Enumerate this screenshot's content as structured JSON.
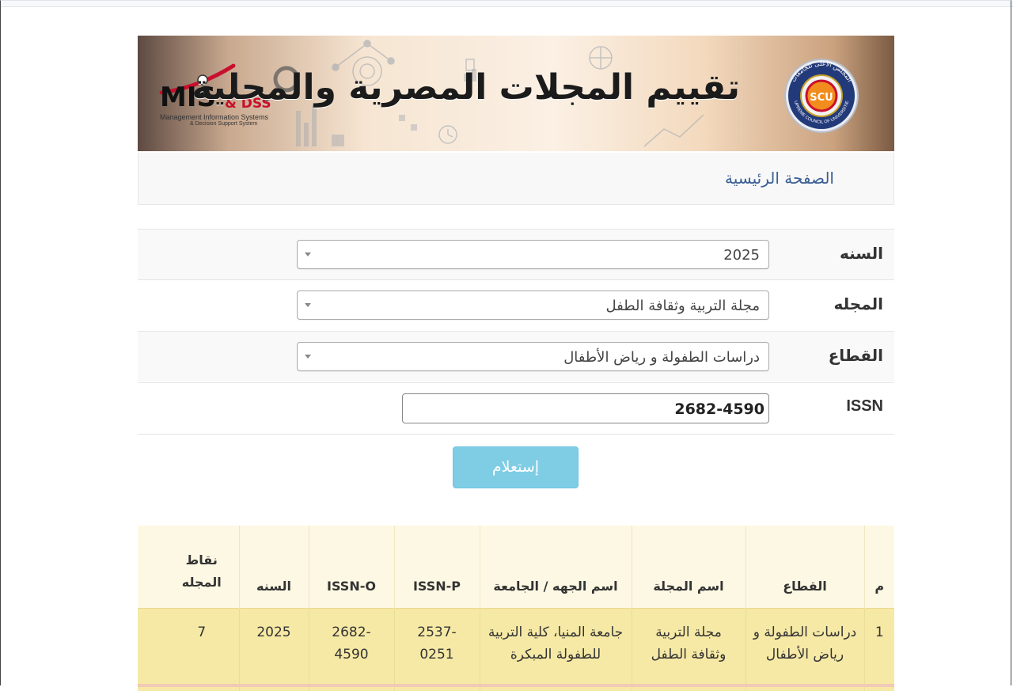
{
  "banner": {
    "title": "تقييم المجلات المصرية والمحلية",
    "left_logo": {
      "main": "MIS",
      "amp": "& DSS",
      "line1": "Management Information Systems",
      "line2": "& Decision Support System"
    },
    "right_logo": {
      "initials": "SCU",
      "arabic_name": "المجلس الأعلى للجامعات",
      "english_name": "SUPREME COUNCIL OF UNIVERSITIES"
    }
  },
  "nav": {
    "home_label": "الصفحة الرئيسية"
  },
  "form": {
    "year": {
      "label": "السنه",
      "value": "2025"
    },
    "journal": {
      "label": "المجله",
      "value": "مجلة التربية وثقافة الطفل"
    },
    "sector": {
      "label": "القطاع",
      "value": "دراسات الطفولة و رياض الأطفال"
    },
    "issn": {
      "label": "ISSN",
      "value": "2682-4590"
    },
    "submit_label": "إستعلام"
  },
  "results": {
    "headers": [
      "م",
      "القطاع",
      "اسم المجلة",
      "اسم الجهه / الجامعة",
      "ISSN-P",
      "ISSN-O",
      "السنه",
      "نقاط المجله"
    ],
    "rows": [
      [
        "1",
        "دراسات الطفولة و رياض الأطفال",
        "مجلة التربية وثقافة الطفل",
        "جامعة المنيا، كلية التربية للطفولة المبكرة",
        "2537-0251",
        "2682-4590",
        "2025",
        "7"
      ]
    ]
  },
  "colors": {
    "button": "#5bc0de",
    "table_header": "#fcf8e3",
    "table_row": "#f6e9a5",
    "nav_link": "#3b5f95"
  }
}
